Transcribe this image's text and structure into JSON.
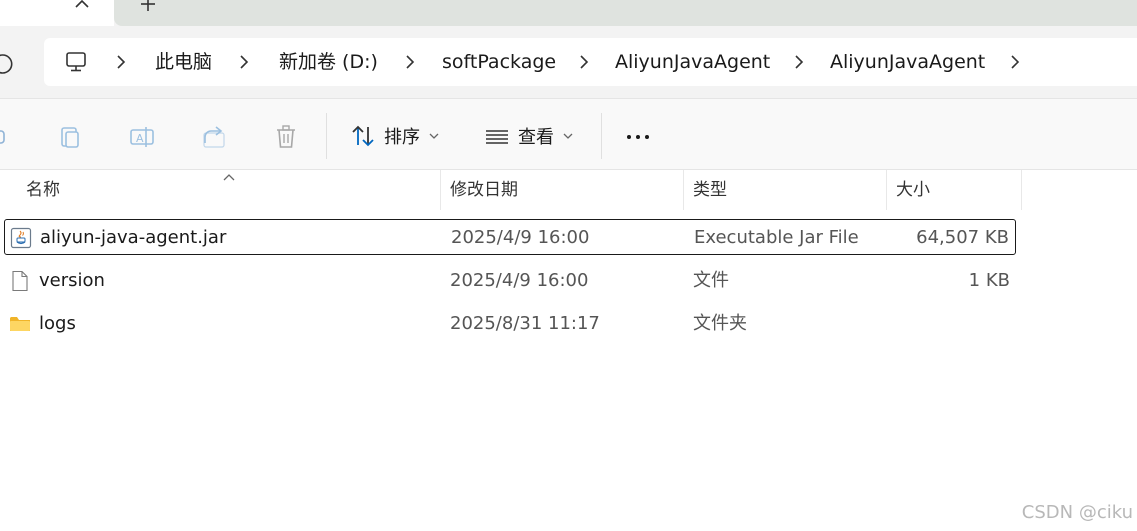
{
  "breadcrumb": {
    "items": [
      "此电脑",
      "新加卷 (D:)",
      "softPackage",
      "AliyunJavaAgent",
      "AliyunJavaAgent"
    ]
  },
  "toolbar": {
    "sort_label": "排序",
    "view_label": "查看"
  },
  "columns": {
    "name": "名称",
    "date": "修改日期",
    "type": "类型",
    "size": "大小"
  },
  "files": [
    {
      "name": "aliyun-java-agent.jar",
      "date": "2025/4/9 16:00",
      "type": "Executable Jar File",
      "size": "64,507 KB",
      "icon": "jar-file-icon",
      "selected": true
    },
    {
      "name": "version",
      "date": "2025/4/9 16:00",
      "type": "文件",
      "size": "1 KB",
      "icon": "file-icon",
      "selected": false
    },
    {
      "name": "logs",
      "date": "2025/8/31 11:17",
      "type": "文件夹",
      "size": "",
      "icon": "folder-icon",
      "selected": false
    }
  ],
  "watermark": "CSDN @ciku",
  "colors": {
    "accent": "#0067c0",
    "folder": "#f8c540",
    "selection_border": "#1a1a1a"
  }
}
